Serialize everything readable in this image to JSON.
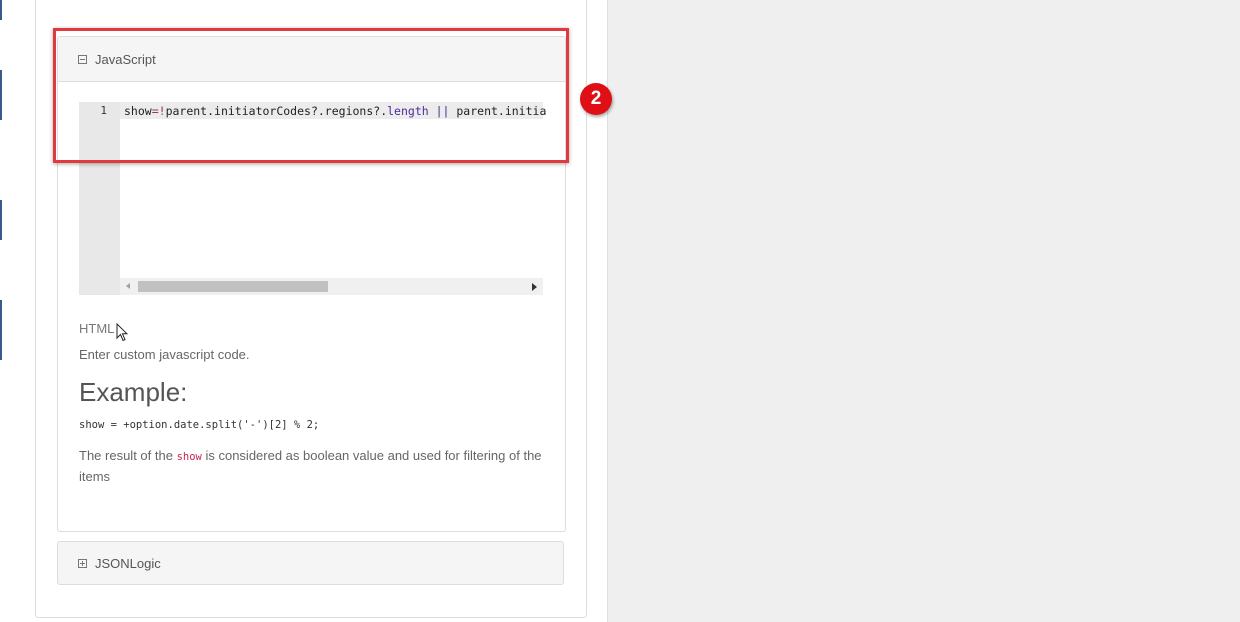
{
  "javascript_panel": {
    "title": "JavaScript",
    "toggle_icon": "minus-square-icon",
    "editor": {
      "line_number": "1",
      "code": {
        "t1": "show",
        "t2": "=!",
        "t3": "parent.initiatorCodes?.regions?.",
        "t4": "length",
        "t5": " || ",
        "t6": "parent.initia"
      }
    },
    "help": {
      "html_label": "HTML",
      "description": "Enter custom javascript code.",
      "example_heading": "Example:",
      "example_code": "show = +option.date.split('-')[2] % 2;",
      "result_prefix": "The result of the ",
      "result_code": "show",
      "result_suffix": " is considered as boolean value and used for filtering of the items"
    }
  },
  "jsonlogic_panel": {
    "title": "JSONLogic",
    "toggle_icon": "plus-square-icon"
  },
  "annotation": {
    "badge_number": "2",
    "highlight_color": "#e0393e",
    "badge_color": "#e00f16"
  }
}
